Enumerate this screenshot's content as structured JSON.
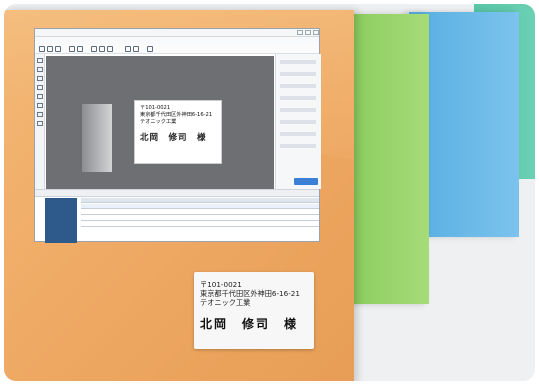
{
  "software_label": {
    "postal": "〒101-0021",
    "address": "東京都千代田区外神田6-16-21",
    "company": "テオニック工業",
    "name": "北岡　修司　様"
  },
  "printed_label": {
    "postal": "〒101-0021",
    "address": "東京都千代田区外神田6-16-21",
    "company": "テオニック工業",
    "name": "北岡　修司　様"
  },
  "colors": {
    "orange_envelope": "#eea862",
    "green_envelope": "#86c95a",
    "blue_envelope": "#56aee0",
    "teal_envelope": "#57c6a6",
    "canvas": "#6d6f72",
    "thumbnail": "#2e5a8b"
  }
}
